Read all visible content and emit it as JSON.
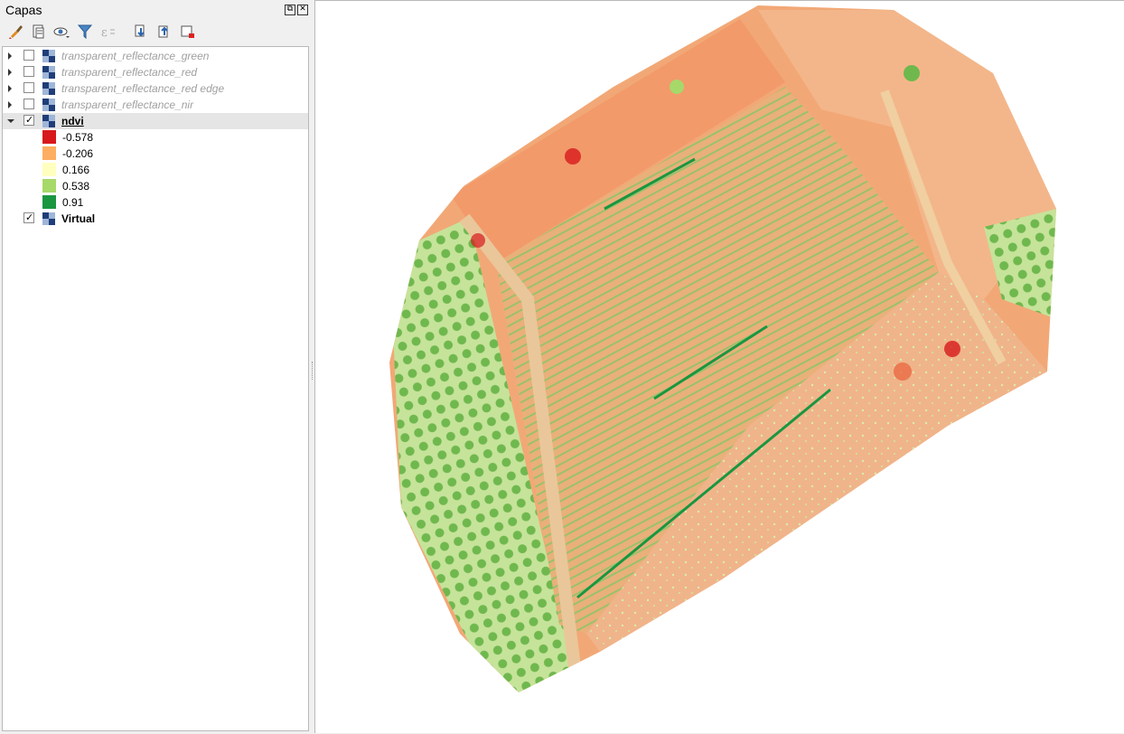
{
  "panel": {
    "title": "Capas"
  },
  "toolbar": [
    {
      "name": "style-brush-icon"
    },
    {
      "name": "add-group-icon"
    },
    {
      "name": "visibility-eye-icon"
    },
    {
      "name": "filter-icon"
    },
    {
      "name": "filter-expression-icon"
    },
    {
      "name": "expand-all-icon"
    },
    {
      "name": "collapse-all-icon"
    },
    {
      "name": "remove-layer-icon"
    }
  ],
  "layers": [
    {
      "label": "transparent_reflectance_green",
      "checked": false,
      "expanded": false
    },
    {
      "label": "transparent_reflectance_red",
      "checked": false,
      "expanded": false
    },
    {
      "label": "transparent_reflectance_red edge",
      "checked": false,
      "expanded": false
    },
    {
      "label": "transparent_reflectance_nir",
      "checked": false,
      "expanded": false
    },
    {
      "label": "ndvi",
      "checked": true,
      "expanded": true
    },
    {
      "label": "Virtual",
      "checked": true,
      "expanded": false
    }
  ],
  "legend": [
    {
      "value": "-0.578",
      "color": "#d7191c"
    },
    {
      "value": "-0.206",
      "color": "#fdae61"
    },
    {
      "value": "0.166",
      "color": "#ffffc0"
    },
    {
      "value": "0.538",
      "color": "#a6d96a"
    },
    {
      "value": "0.91",
      "color": "#1a9641"
    }
  ]
}
